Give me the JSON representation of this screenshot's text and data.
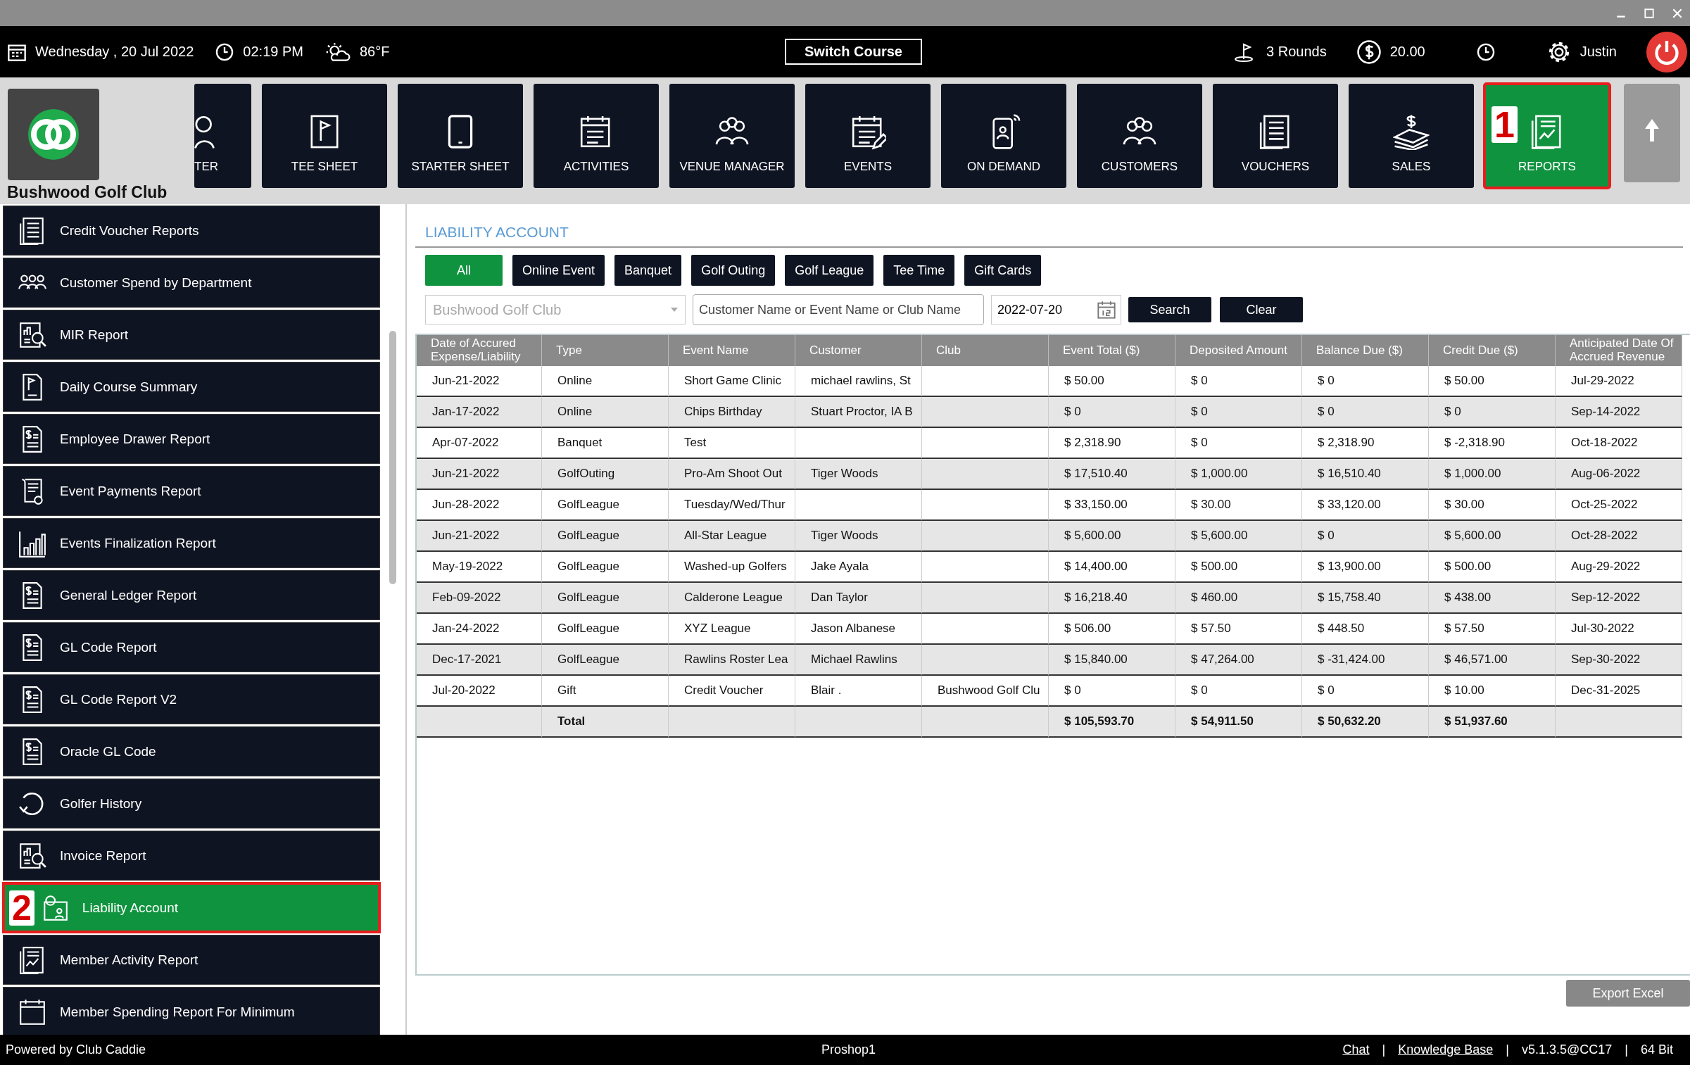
{
  "top_bar": {
    "date": "Wednesday ,  20 Jul 2022",
    "time": "02:19 PM",
    "weather": "86°F",
    "switch_course": "Switch Course",
    "rounds": "3 Rounds",
    "balance": "20.00",
    "user": "Justin"
  },
  "club": {
    "name": "Bushwood Golf Club"
  },
  "nav": [
    {
      "label": "TER",
      "kind": "person",
      "selected": false,
      "cut": true
    },
    {
      "label": "TEE SHEET",
      "kind": "flag",
      "selected": false
    },
    {
      "label": "STARTER SHEET",
      "kind": "tablet",
      "selected": false
    },
    {
      "label": "ACTIVITIES",
      "kind": "calendar",
      "selected": false
    },
    {
      "label": "VENUE MANAGER",
      "kind": "people",
      "selected": false
    },
    {
      "label": "EVENTS",
      "kind": "calendarpen",
      "selected": false
    },
    {
      "label": "ON DEMAND",
      "kind": "phone",
      "selected": false
    },
    {
      "label": "CUSTOMERS",
      "kind": "people",
      "selected": false
    },
    {
      "label": "VOUCHERS",
      "kind": "list",
      "selected": false
    },
    {
      "label": "SALES",
      "kind": "money",
      "selected": false
    },
    {
      "label": "REPORTS",
      "kind": "report",
      "selected": true,
      "callout": "1"
    }
  ],
  "sidebar": {
    "items": [
      {
        "label": "Credit Voucher Reports",
        "kind": "list",
        "selected": false
      },
      {
        "label": "Customer Spend by Department",
        "kind": "people",
        "selected": false
      },
      {
        "label": "MIR Report",
        "kind": "chart",
        "selected": false
      },
      {
        "label": "Daily Course Summary",
        "kind": "flag",
        "selected": false
      },
      {
        "label": "Employee Drawer Report",
        "kind": "dollar",
        "selected": false
      },
      {
        "label": "Event Payments Report",
        "kind": "receipt",
        "selected": false
      },
      {
        "label": "Events Finalization Report",
        "kind": "bars",
        "selected": false
      },
      {
        "label": "General Ledger Report",
        "kind": "dollar",
        "selected": false
      },
      {
        "label": "GL Code Report",
        "kind": "dollar",
        "selected": false
      },
      {
        "label": "GL Code Report V2",
        "kind": "dollar",
        "selected": false
      },
      {
        "label": "Oracle GL Code",
        "kind": "dollar",
        "selected": false
      },
      {
        "label": "Golfer History",
        "kind": "history",
        "selected": false
      },
      {
        "label": "Invoice Report",
        "kind": "chart",
        "selected": false
      },
      {
        "label": "Liability Account",
        "kind": "card",
        "selected": true,
        "callout": "2"
      },
      {
        "label": "Member Activity Report",
        "kind": "report",
        "selected": false
      },
      {
        "label": "Member Spending Report For Minimum",
        "kind": "calendar",
        "selected": false
      }
    ]
  },
  "section_title": "LIABILITY ACCOUNT",
  "filters": [
    {
      "label": "All",
      "selected": true
    },
    {
      "label": "Online Event",
      "selected": false
    },
    {
      "label": "Banquet",
      "selected": false
    },
    {
      "label": "Golf Outing",
      "selected": false
    },
    {
      "label": "Golf League",
      "selected": false
    },
    {
      "label": "Tee Time",
      "selected": false
    },
    {
      "label": "Gift Cards",
      "selected": false
    }
  ],
  "club_select": {
    "value": "Bushwood Golf Club",
    "disabled": true
  },
  "search_field": {
    "placeholder": "Customer Name or Event Name or Club Name"
  },
  "date_field": {
    "value": "2022-07-20"
  },
  "buttons": [
    "Search",
    "Clear"
  ],
  "table": {
    "columns": [
      "Date of Accured Expense/Liability",
      "Type",
      "Event Name",
      "Customer",
      "Club",
      "Event Total ($)",
      "Deposited Amount",
      "Balance Due ($)",
      "Credit Due ($)",
      "Anticipated Date Of Accrued Revenue"
    ],
    "rows": [
      [
        "Jun-21-2022",
        "Online",
        "Short Game Clinic",
        "michael rawlins, St",
        null,
        "$ 50.00",
        "$ 0",
        "$ 0",
        "$ 50.00",
        "Jul-29-2022"
      ],
      [
        "Jan-17-2022",
        "Online",
        "Chips Birthday",
        "Stuart Proctor, IA B",
        null,
        "$ 0",
        "$ 0",
        "$ 0",
        "$ 0",
        "Sep-14-2022"
      ],
      [
        "Apr-07-2022",
        "Banquet",
        "Test",
        null,
        null,
        "$ 2,318.90",
        "$ 0",
        "$ 2,318.90",
        "$ -2,318.90",
        "Oct-18-2022"
      ],
      [
        "Jun-21-2022",
        "GolfOuting",
        "Pro-Am Shoot Out",
        "Tiger Woods",
        null,
        "$ 17,510.40",
        "$ 1,000.00",
        "$ 16,510.40",
        "$ 1,000.00",
        "Aug-06-2022"
      ],
      [
        "Jun-28-2022",
        "GolfLeague",
        "Tuesday/Wed/Thur",
        null,
        null,
        "$ 33,150.00",
        "$ 30.00",
        "$ 33,120.00",
        "$ 30.00",
        "Oct-25-2022"
      ],
      [
        "Jun-21-2022",
        "GolfLeague",
        "All-Star League",
        "Tiger Woods",
        null,
        "$ 5,600.00",
        "$ 5,600.00",
        "$ 0",
        "$ 5,600.00",
        "Oct-28-2022"
      ],
      [
        "May-19-2022",
        "GolfLeague",
        "Washed-up Golfers",
        "Jake Ayala",
        null,
        "$ 14,400.00",
        "$ 500.00",
        "$ 13,900.00",
        "$ 500.00",
        "Aug-29-2022"
      ],
      [
        "Feb-09-2022",
        "GolfLeague",
        "Calderone League",
        "Dan Taylor",
        null,
        "$ 16,218.40",
        "$ 460.00",
        "$ 15,758.40",
        "$ 438.00",
        "Sep-12-2022"
      ],
      [
        "Jan-24-2022",
        "GolfLeague",
        "XYZ League",
        "Jason Albanese",
        null,
        "$ 506.00",
        "$ 57.50",
        "$ 448.50",
        "$ 57.50",
        "Jul-30-2022"
      ],
      [
        "Dec-17-2021",
        "GolfLeague",
        "Rawlins Roster Lea",
        "Michael Rawlins",
        null,
        "$ 15,840.00",
        "$ 47,264.00",
        "$ -31,424.00",
        "$ 46,571.00",
        "Sep-30-2022"
      ],
      [
        "Jul-20-2022",
        "Gift",
        "Credit Voucher",
        "Blair .",
        "Bushwood Golf Clu",
        "$ 0",
        "$ 0",
        "$ 0",
        "$ 10.00",
        "Dec-31-2025"
      ]
    ],
    "total": {
      "label": "Total",
      "amounts": [
        "$ 105,593.70",
        "$ 54,911.50",
        "$ 50,632.20",
        "$ 51,937.60"
      ]
    }
  },
  "export_button": "Export Excel",
  "footer": {
    "left": "Powered by Club Caddie",
    "center": "Proshop1",
    "right": [
      {
        "kind": "link",
        "text": "Chat"
      },
      {
        "kind": "separator",
        "text": "|"
      },
      {
        "kind": "link",
        "text": "Knowledge Base"
      },
      {
        "kind": "separator",
        "text": "|"
      },
      {
        "kind": "text",
        "text": "v5.1.3.5@CC17"
      },
      {
        "kind": "separator",
        "text": "|"
      },
      {
        "kind": "text",
        "text": "64 Bit"
      }
    ]
  }
}
